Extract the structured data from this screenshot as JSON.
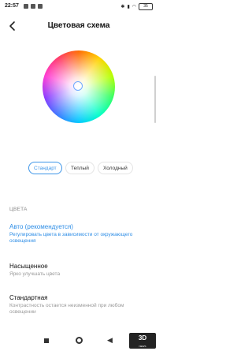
{
  "status": {
    "time": "22:57",
    "battery": "35"
  },
  "header": {
    "title": "Цветовая схема"
  },
  "modes": [
    {
      "label": "Стандарт",
      "selected": true
    },
    {
      "label": "Теплый",
      "selected": false
    },
    {
      "label": "Холодный",
      "selected": false
    }
  ],
  "section_label": "ЦВЕТА",
  "options": [
    {
      "title": "Авто (рекомендуется)",
      "subtitle": "Регулировать цвета в зависимости от окружающего освещения",
      "selected": true
    },
    {
      "title": "Насыщенное",
      "subtitle": "Ярко улучшать цвета",
      "selected": false
    },
    {
      "title": "Стандартная",
      "subtitle": "Контрастность остается неизменной при любом освещении",
      "selected": false
    }
  ],
  "watermark": {
    "text": "3D",
    "small": "NEWS"
  },
  "colors": {
    "accent": "#2f8ee6"
  }
}
